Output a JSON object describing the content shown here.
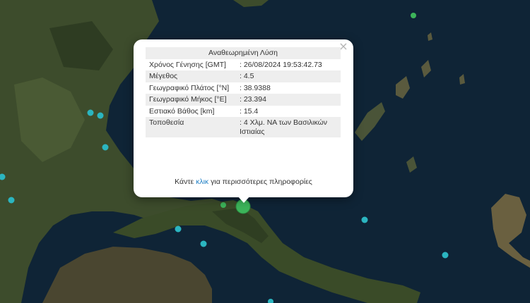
{
  "popup": {
    "title": "Αναθεωρημένη Λύση",
    "close_symbol": "×",
    "rows": [
      {
        "label": "Χρόνος Γένησης [GMT]",
        "value": ": 26/08/2024 19:53:42.73"
      },
      {
        "label": "Μέγεθος",
        "value": ": 4.5"
      },
      {
        "label": "Γεωγραφικό Πλάτος [°N]",
        "value": ": 38.9388"
      },
      {
        "label": "Γεωγραφικό Μήκος [°E]",
        "value": ": 23.394"
      },
      {
        "label": "Εστιακό Βάθος [km]",
        "value": ": 15.4"
      },
      {
        "label": "Τοποθεσία",
        "value": ": 4 Χλμ. ΝΑ των Βασιλικών Ιστιαίας"
      }
    ],
    "more_prefix": "Κάντε ",
    "more_link": "κλικ",
    "more_suffix": " για περισσότερες πληροφορίες"
  },
  "map": {
    "sea_color": "#0f2436",
    "land_color": "#3a4a2a",
    "marker_color_recent": "#3cb45a",
    "marker_color_old": "#2bb5c0",
    "markers": [
      {
        "type": "main-event",
        "color": "green"
      },
      {
        "type": "event",
        "color": "green"
      },
      {
        "type": "event",
        "color": "green"
      },
      {
        "type": "event",
        "color": "cyan"
      }
    ]
  }
}
